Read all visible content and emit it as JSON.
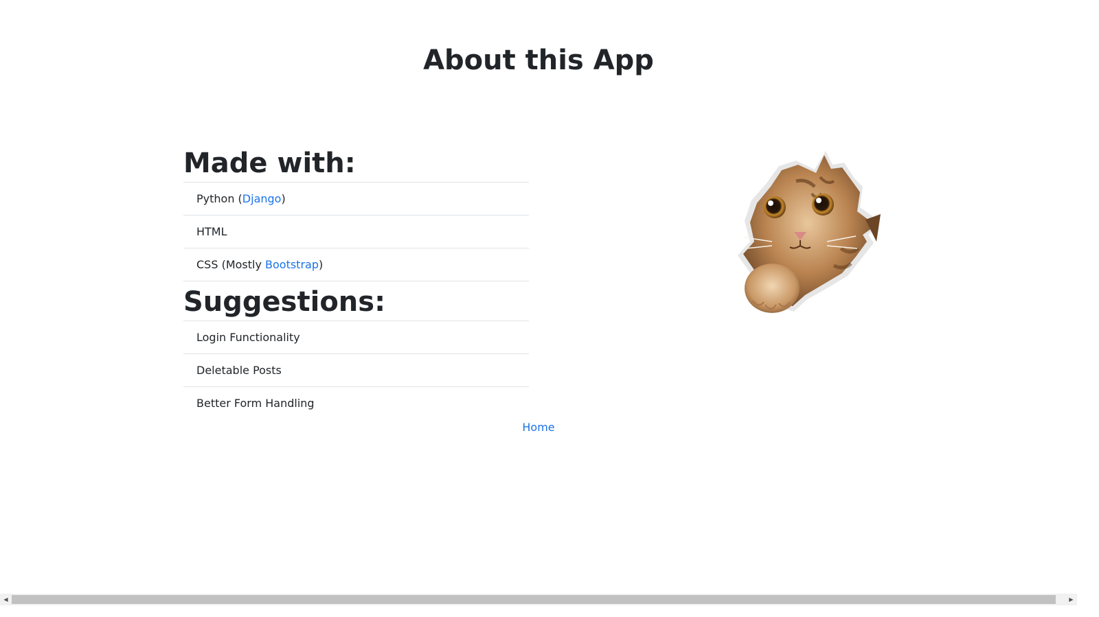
{
  "page": {
    "title": "About this App"
  },
  "made_with": {
    "heading": "Made with:",
    "items": [
      {
        "prefix": "Python (",
        "link": "Django",
        "suffix": ")"
      },
      {
        "text": "HTML"
      },
      {
        "prefix": "CSS (Mostly ",
        "link": "Bootstrap",
        "suffix": ")"
      }
    ]
  },
  "suggestions": {
    "heading": "Suggestions:",
    "items": [
      "Login Functionality",
      "Deletable Posts",
      "Better Form Handling"
    ]
  },
  "nav": {
    "home_label": "Home"
  },
  "image": {
    "icon": "cat-peeking-through-paper-image"
  },
  "colors": {
    "link": "#1a73e8",
    "text": "#212529",
    "divider": "#dee2e6"
  }
}
